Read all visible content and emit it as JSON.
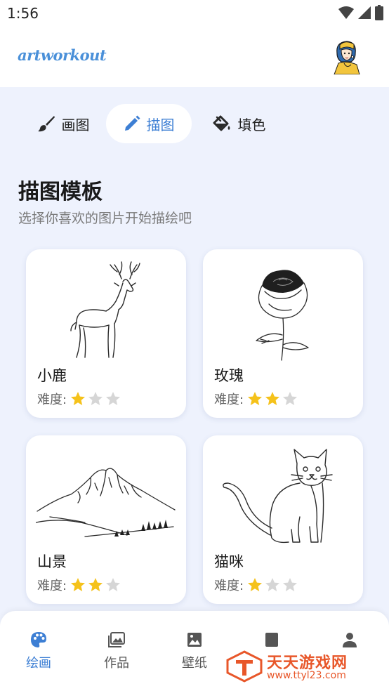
{
  "status_bar": {
    "time": "1:56"
  },
  "header": {
    "logo": "artworkout"
  },
  "tabs": [
    {
      "label": "画图",
      "icon": "brush-icon",
      "active": false
    },
    {
      "label": "描图",
      "icon": "pencil-icon",
      "active": true
    },
    {
      "label": "填色",
      "icon": "paint-bucket-icon",
      "active": false
    }
  ],
  "section": {
    "title": "描图模板",
    "subtitle": "选择你喜欢的图片开始描绘吧"
  },
  "templates": [
    {
      "name": "小鹿",
      "difficulty_label": "难度:",
      "difficulty": 1,
      "max": 3
    },
    {
      "name": "玫瑰",
      "difficulty_label": "难度:",
      "difficulty": 2,
      "max": 3
    },
    {
      "name": "山景",
      "difficulty_label": "难度:",
      "difficulty": 2,
      "max": 3
    },
    {
      "name": "猫咪",
      "difficulty_label": "难度:",
      "difficulty": 1,
      "max": 3
    }
  ],
  "bottom_nav": [
    {
      "label": "绘画",
      "icon": "palette-icon",
      "active": true
    },
    {
      "label": "作品",
      "icon": "gallery-icon",
      "active": false
    },
    {
      "label": "壁纸",
      "icon": "image-icon",
      "active": false
    },
    {
      "label": "",
      "icon": "book-icon",
      "active": false
    },
    {
      "label": "",
      "icon": "profile-icon",
      "active": false
    }
  ],
  "watermark": {
    "text": "天天游戏网",
    "url": "www.ttyl23.com"
  },
  "colors": {
    "accent": "#3d7fd4",
    "star_filled": "#f5c21b",
    "star_empty": "#d6d6d6",
    "background": "#eef2fd",
    "watermark": "#e8572a"
  }
}
